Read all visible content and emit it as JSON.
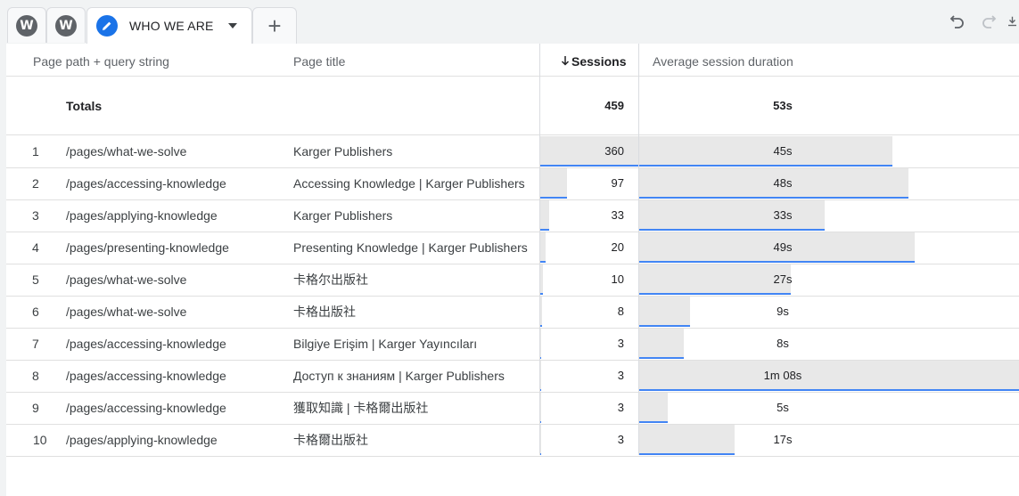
{
  "tabs": {
    "tab1_letter": "W",
    "tab2_letter": "W",
    "active_label": "WHO WE ARE",
    "add_symbol": "+"
  },
  "table": {
    "headers": {
      "path": "Page path + query string",
      "title": "Page title",
      "sessions": "Sessions",
      "duration": "Average session duration"
    },
    "totals": {
      "label": "Totals",
      "sessions": "459",
      "duration": "53s"
    },
    "rows": [
      {
        "idx": "1",
        "path": "/pages/what-we-solve",
        "title": "Karger Publishers",
        "sessions": "360",
        "duration": "45s"
      },
      {
        "idx": "2",
        "path": "/pages/accessing-knowledge",
        "title": "Accessing Knowledge | Karger Publishers",
        "sessions": "97",
        "duration": "48s"
      },
      {
        "idx": "3",
        "path": "/pages/applying-knowledge",
        "title": "Karger Publishers",
        "sessions": "33",
        "duration": "33s"
      },
      {
        "idx": "4",
        "path": "/pages/presenting-knowledge",
        "title": "Presenting Knowledge | Karger Publishers",
        "sessions": "20",
        "duration": "49s"
      },
      {
        "idx": "5",
        "path": "/pages/what-we-solve",
        "title": "卡格尔出版社",
        "sessions": "10",
        "duration": "27s"
      },
      {
        "idx": "6",
        "path": "/pages/what-we-solve",
        "title": "卡格出版社",
        "sessions": "8",
        "duration": "9s"
      },
      {
        "idx": "7",
        "path": "/pages/accessing-knowledge",
        "title": "Bilgiye Erişim | Karger Yayıncıları",
        "sessions": "3",
        "duration": "8s"
      },
      {
        "idx": "8",
        "path": "/pages/accessing-knowledge",
        "title": "Доступ к знаниям | Karger Publishers",
        "sessions": "3",
        "duration": "1m 08s"
      },
      {
        "idx": "9",
        "path": "/pages/accessing-knowledge",
        "title": "獲取知識 | 卡格爾出版社",
        "sessions": "3",
        "duration": "5s"
      },
      {
        "idx": "10",
        "path": "/pages/applying-knowledge",
        "title": "卡格爾出版社",
        "sessions": "3",
        "duration": "17s"
      }
    ]
  },
  "colors": {
    "accent": "#1a73e8",
    "bar_line": "#4285f4",
    "bar_fill": "#e8e8e8"
  }
}
